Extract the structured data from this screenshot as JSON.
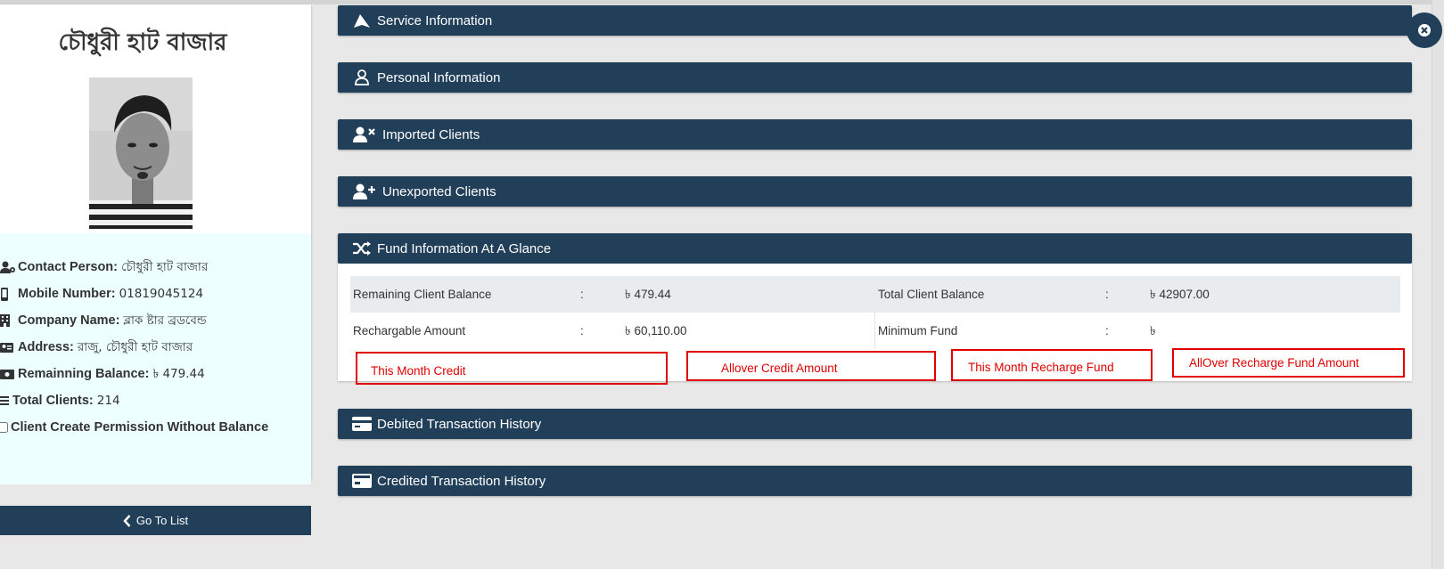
{
  "profile": {
    "title": "চৌধুরী হাট বাজার",
    "photo_alt": "profile photo",
    "contact_person_label": "Contact Person:",
    "contact_person_value": "চৌধুরী হাট বাজার",
    "mobile_label": "Mobile Number:",
    "mobile_value": "01819045124",
    "company_label": "Company Name:",
    "company_value": "ব্লাক ষ্টার ব্রডবেন্ড",
    "address_label": "Address:",
    "address_value": "রাজু, চৌধুরী হাট বাজার",
    "balance_label": "Remainning Balance:",
    "balance_value": "৳ 479.44",
    "clients_label": "Total Clients:",
    "clients_value": "214",
    "permission_label": "Client Create Permission Without Balance",
    "permission_checked": false
  },
  "goto_button": {
    "label": "Go To List"
  },
  "panels": {
    "service": "Service Information",
    "personal": "Personal Information",
    "imported": "Imported Clients",
    "unexported": "Unexported Clients",
    "fund": "Fund Information At A Glance",
    "debited": "Debited Transaction History",
    "credited": "Credited Transaction History"
  },
  "fund": {
    "rows": [
      {
        "left_label": "Remaining Client Balance",
        "sep": ":",
        "left_value": "৳ 479.44",
        "right_label": "Total Client Balance",
        "right_value": "৳ 42907.00"
      },
      {
        "left_label": "Rechargable Amount",
        "sep": ":",
        "left_value": "৳ 60,110.00",
        "right_label": "Minimum Fund",
        "right_value": "৳"
      }
    ]
  },
  "annotations": [
    "This Month Credit",
    "Allover Credit Amount",
    "This Month Recharge Fund",
    "AllOver Recharge Fund Amount"
  ],
  "colors": {
    "header": "#223f5a",
    "info_bg": "#eeffff",
    "annotation": "#e00000"
  }
}
